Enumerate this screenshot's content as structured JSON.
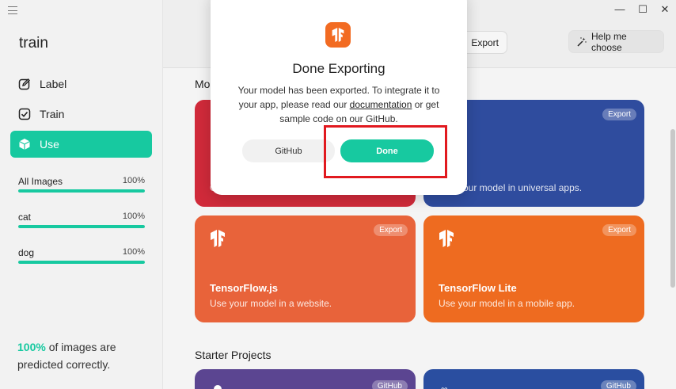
{
  "sidebar": {
    "title": "train",
    "nav": [
      {
        "label": "Label",
        "icon": "edit-icon"
      },
      {
        "label": "Train",
        "icon": "checkbox-icon"
      },
      {
        "label": "Use",
        "icon": "cube-icon",
        "active": true
      }
    ],
    "metrics": [
      {
        "label": "All Images",
        "value": "100%",
        "fraction": 1.0
      },
      {
        "label": "cat",
        "value": "100%",
        "fraction": 1.0
      },
      {
        "label": "dog",
        "value": "100%",
        "fraction": 1.0
      }
    ],
    "summary_highlight": "100%",
    "summary_text": " of images are predicted correctly."
  },
  "toolbar": {
    "export_label": "Export",
    "help_label": "Help me choose"
  },
  "main": {
    "section_models_partial": "Mo",
    "section_starter": "Starter Projects",
    "cards": {
      "red_partial": "C",
      "blue_desc_partial": "your model in universal apps.",
      "blue_badge": "Export",
      "tfjs": {
        "title": "TensorFlow.js",
        "desc": "Use your model in a website.",
        "badge": "Export"
      },
      "tflite": {
        "title": "TensorFlow Lite",
        "desc": "Use your model in a mobile app.",
        "badge": "Export"
      },
      "starter1_badge": "GitHub",
      "starter2_badge": "GitHub"
    }
  },
  "modal": {
    "title": "Done Exporting",
    "body_before": "Your model has been exported. To integrate it to your app, please read our ",
    "link": "documentation",
    "body_after": " or get sample code on our GitHub.",
    "github_button": "GitHub",
    "done_button": "Done"
  },
  "colors": {
    "accent": "#17c9a0",
    "red_card": "#d02a3a",
    "blue_card": "#2f4c9e",
    "tfjs_card": "#e8633a",
    "tflite_card": "#ee6b20",
    "starter_purple": "#5b4591",
    "starter_blue": "#2a4ea0",
    "highlight": "#e1191f"
  }
}
